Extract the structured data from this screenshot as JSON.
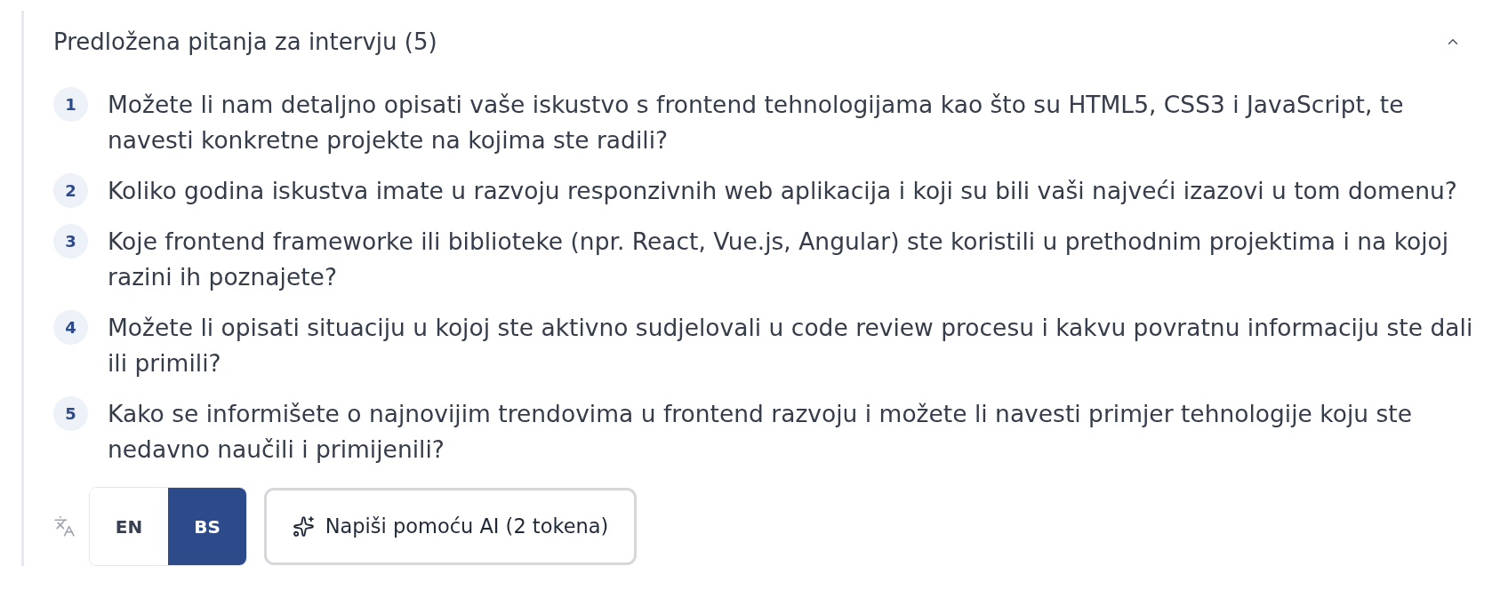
{
  "section": {
    "title": "Predložena pitanja za intervju (5)",
    "expanded": true
  },
  "questions": [
    {
      "number": "1",
      "text": "Možete li nam detaljno opisati vaše iskustvo s frontend tehnologijama kao što su HTML5, CSS3 i JavaScript, te navesti konkretne projekte na kojima ste radili?"
    },
    {
      "number": "2",
      "text": "Koliko godina iskustva imate u razvoju responzivnih web aplikacija i koji su bili vaši najveći izazovi u tom domenu?"
    },
    {
      "number": "3",
      "text": "Koje frontend frameworke ili biblioteke (npr. React, Vue.js, Angular) ste koristili u prethodnim projektima i na kojoj razini ih poznajete?"
    },
    {
      "number": "4",
      "text": "Možete li opisati situaciju u kojoj ste aktivno sudjelovali u code review procesu i kakvu povratnu informaciju ste dali ili primili?"
    },
    {
      "number": "5",
      "text": "Kako se informišete o najnovijim trendovima u frontend razvoju i možete li navesti primjer tehnologije koju ste nedavno naučili i primijenili?"
    }
  ],
  "language_toggle": [
    {
      "label": "EN",
      "selected": false
    },
    {
      "label": "BS",
      "selected": true
    }
  ],
  "ai_button": {
    "label": "Napiši pomoću AI (2 tokena)"
  }
}
